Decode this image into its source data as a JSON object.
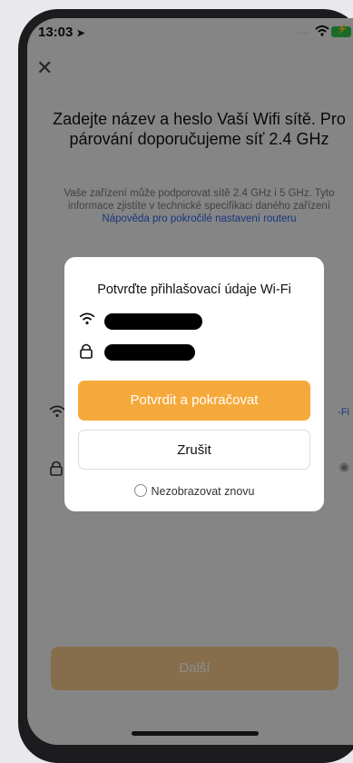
{
  "status_bar": {
    "time": "13:03",
    "carrier_dots": "...."
  },
  "background": {
    "heading": "Zadejte název a heslo Vaší Wifi sítě. Pro párování doporučujeme síť 2.4 GHz",
    "subtext": "Vaše zařízení může podporovat sítě 2.4 GHz i 5 GHz. Tyto informace zjistíte v technické specifikaci daného zařízení",
    "help_link": "Nápověda pro pokročilé nastavení routeru",
    "wifi_row_suffix": "-Fi",
    "next_label": "Další"
  },
  "dialog": {
    "title": "Potvrďte přihlašovací údaje Wi-Fi",
    "confirm_label": "Potvrdit a pokračovat",
    "cancel_label": "Zrušit",
    "dont_show_label": "Nezobrazovat znovu"
  },
  "colors": {
    "accent": "#f6a93b",
    "link": "#2b67e0"
  },
  "icons": [
    "location-arrow-icon",
    "wifi-icon",
    "battery-charging-icon",
    "close-icon",
    "lock-icon",
    "eye-icon"
  ]
}
